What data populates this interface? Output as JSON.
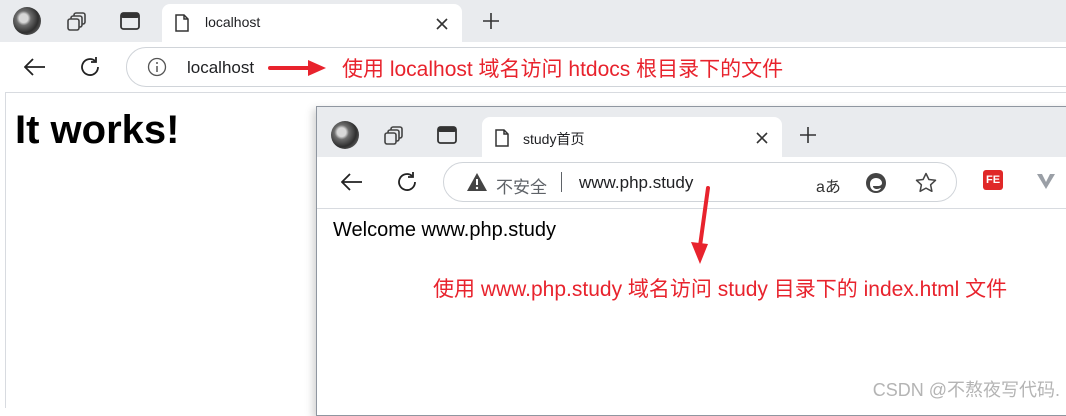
{
  "back_browser": {
    "tab_title": "localhost",
    "address": "localhost",
    "page_heading": "It works!",
    "annotation": "使用 localhost 域名访问 htdocs 根目录下的文件"
  },
  "front_browser": {
    "tab_title": "study首页",
    "security_label": "不安全",
    "address": "www.php.study",
    "reader_label": "aあ",
    "page_text": "Welcome www.php.study",
    "extension_label": "FE",
    "annotation": "使用 www.php.study 域名访问 study 目录下的 index.html 文件"
  },
  "watermark": "CSDN @不熬夜写代码.",
  "colors": {
    "annotation": "#e8232d",
    "tab_bar": "#e9ebee"
  },
  "icons": [
    "avatar",
    "workspaces-icon",
    "tab-actions-icon",
    "page-icon",
    "close-icon",
    "new-tab-icon",
    "back-icon",
    "refresh-icon",
    "info-icon",
    "warning-icon",
    "read-aloud-icon",
    "edge-icon",
    "favorite-icon",
    "extension-icon",
    "vpn-icon"
  ]
}
